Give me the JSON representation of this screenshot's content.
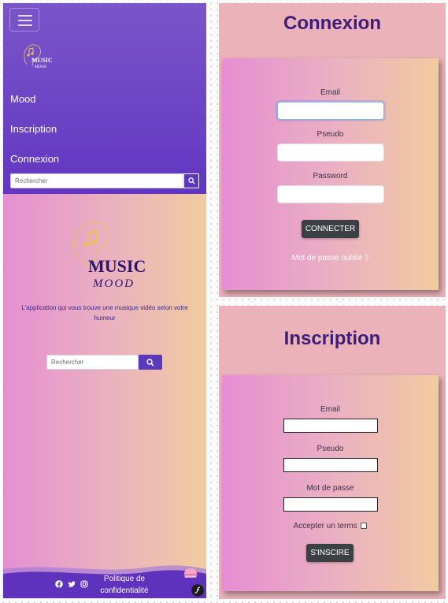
{
  "mobile": {
    "logo": {
      "text_line1": "MUSIC",
      "text_line2": "MOOD"
    },
    "nav": {
      "menu_icon": "hamburger-icon",
      "items": [
        {
          "label": "Mood"
        },
        {
          "label": "Inscription"
        },
        {
          "label": "Connexion"
        }
      ],
      "search": {
        "placeholder": "Rechercher",
        "icon": "search-icon"
      }
    },
    "hero": {
      "logo_text_line1": "MUSIC",
      "logo_text_line2": "MOOD",
      "tagline": "L'application qui vous trouve une musique vidéo selon votre humeur",
      "search": {
        "placeholder": "Rechercher",
        "icon": "search-icon"
      }
    },
    "footer": {
      "social_icons": [
        "facebook-icon",
        "twitter-icon",
        "instagram-icon"
      ],
      "policy_label": "Politique de confidentialité",
      "cookie_icon": "cookie-icon",
      "symfony_icon": "symfony-icon"
    },
    "colors": {
      "nav": "#6a40c4",
      "accent": "#5b38bc",
      "gradient_start": "#e58fd3",
      "gradient_end": "#f1cba0"
    }
  },
  "connexion": {
    "title": "Connexion",
    "fields": [
      {
        "label": "Email",
        "value": ""
      },
      {
        "label": "Pseudo",
        "value": ""
      },
      {
        "label": "Password",
        "value": ""
      }
    ],
    "submit_label": "CONNECTER",
    "forgot_label": "Mot de passe oublié ?"
  },
  "inscription": {
    "title": "Inscription",
    "fields": [
      {
        "label": "Email",
        "value": ""
      },
      {
        "label": "Pseudo",
        "value": ""
      },
      {
        "label": "Mot de passe",
        "value": ""
      }
    ],
    "terms_label": "Accepter un terms",
    "terms_checked": false,
    "submit_label": "S'INSCIRE"
  }
}
